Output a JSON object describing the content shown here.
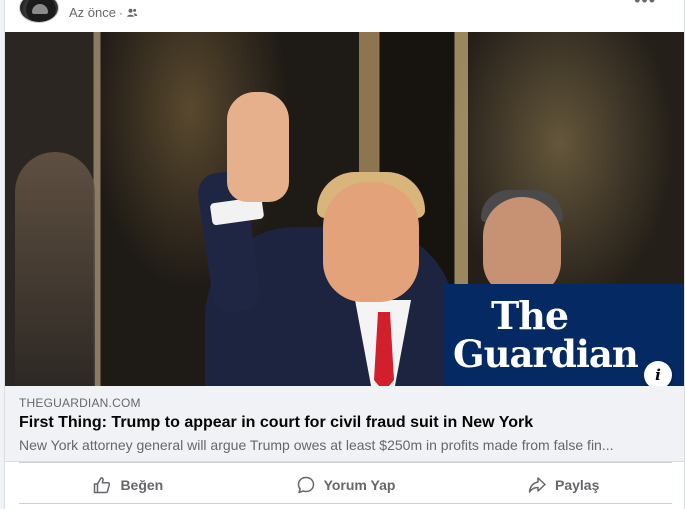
{
  "post": {
    "time": "Az önce",
    "separator": "·",
    "audience_icon": "friends-icon",
    "more_icon": "more-icon"
  },
  "media": {
    "logo_line1": "The",
    "logo_line2": "Guardian",
    "info_label": "i"
  },
  "link": {
    "domain": "THEGUARDIAN.COM",
    "title": "First Thing: Trump to appear in court for civil fraud suit in New York",
    "description": "New York attorney general will argue Trump owes at least $250m in profits made from false fin..."
  },
  "actions": {
    "like": "Beğen",
    "comment": "Yorum Yap",
    "share": "Paylaş"
  },
  "colors": {
    "guardian_blue": "#052962",
    "secondary_text": "#65676b",
    "preview_bg": "#f0f2f5"
  }
}
